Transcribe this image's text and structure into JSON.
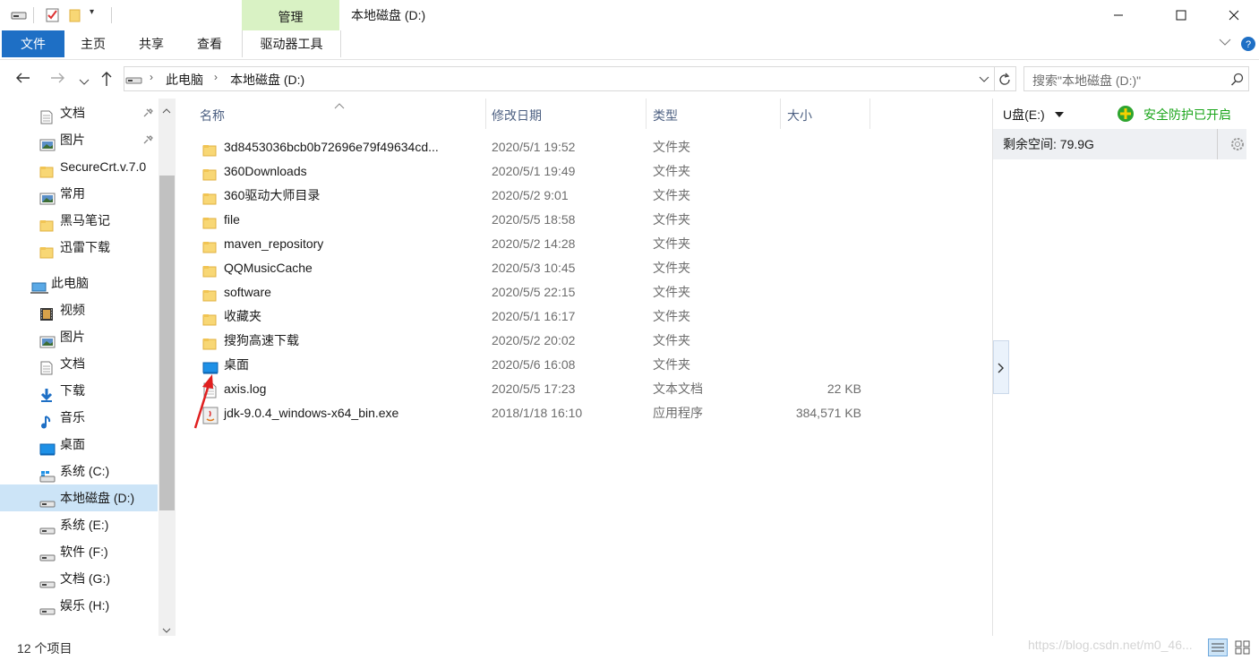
{
  "window": {
    "title": "本地磁盘 (D:)",
    "context_group": "管理"
  },
  "ribbon": {
    "tabs": [
      "文件",
      "主页",
      "共享",
      "查看"
    ],
    "drive_tab": "驱动器工具"
  },
  "address": {
    "crumbs": [
      "此电脑",
      "本地磁盘 (D:)"
    ],
    "search_placeholder": "搜索\"本地磁盘 (D:)\""
  },
  "nav": {
    "quick": [
      {
        "label": "文档",
        "icon": "document-icon",
        "pinned": true
      },
      {
        "label": "图片",
        "icon": "pictures-icon",
        "pinned": true
      },
      {
        "label": "SecureCrt.v.7.0",
        "icon": "folder-icon",
        "pinned": false
      },
      {
        "label": "常用",
        "icon": "pictures-icon",
        "pinned": false
      },
      {
        "label": "黑马笔记",
        "icon": "folder-icon",
        "pinned": false
      },
      {
        "label": "迅雷下载",
        "icon": "folder-icon",
        "pinned": false
      }
    ],
    "this_pc": "此电脑",
    "pc_items": [
      {
        "label": "视频",
        "icon": "video-icon"
      },
      {
        "label": "图片",
        "icon": "pictures-icon"
      },
      {
        "label": "文档",
        "icon": "document-icon"
      },
      {
        "label": "下载",
        "icon": "download-icon"
      },
      {
        "label": "音乐",
        "icon": "music-icon"
      },
      {
        "label": "桌面",
        "icon": "desktop-icon"
      },
      {
        "label": "系统 (C:)",
        "icon": "windows-drive-icon"
      },
      {
        "label": "本地磁盘 (D:)",
        "icon": "drive-icon",
        "selected": true
      },
      {
        "label": "系统 (E:)",
        "icon": "drive-icon"
      },
      {
        "label": "软件 (F:)",
        "icon": "drive-icon"
      },
      {
        "label": "文档 (G:)",
        "icon": "drive-icon"
      },
      {
        "label": "娱乐 (H:)",
        "icon": "drive-icon"
      }
    ]
  },
  "columns": {
    "name": "名称",
    "date": "修改日期",
    "type": "类型",
    "size": "大小"
  },
  "files": [
    {
      "name": "3d8453036bcb0b72696e79f49634cd...",
      "date": "2020/5/1 19:52",
      "type": "文件夹",
      "size": "",
      "icon": "folder-icon"
    },
    {
      "name": "360Downloads",
      "date": "2020/5/1 19:49",
      "type": "文件夹",
      "size": "",
      "icon": "folder-icon"
    },
    {
      "name": "360驱动大师目录",
      "date": "2020/5/2 9:01",
      "type": "文件夹",
      "size": "",
      "icon": "folder-icon"
    },
    {
      "name": "file",
      "date": "2020/5/5 18:58",
      "type": "文件夹",
      "size": "",
      "icon": "folder-icon"
    },
    {
      "name": "maven_repository",
      "date": "2020/5/2 14:28",
      "type": "文件夹",
      "size": "",
      "icon": "folder-icon"
    },
    {
      "name": "QQMusicCache",
      "date": "2020/5/3 10:45",
      "type": "文件夹",
      "size": "",
      "icon": "folder-icon"
    },
    {
      "name": "software",
      "date": "2020/5/5 22:15",
      "type": "文件夹",
      "size": "",
      "icon": "folder-icon"
    },
    {
      "name": "收藏夹",
      "date": "2020/5/1 16:17",
      "type": "文件夹",
      "size": "",
      "icon": "folder-icon"
    },
    {
      "name": "搜狗高速下载",
      "date": "2020/5/2 20:02",
      "type": "文件夹",
      "size": "",
      "icon": "folder-icon"
    },
    {
      "name": "桌面",
      "date": "2020/5/6 16:08",
      "type": "文件夹",
      "size": "",
      "icon": "desktop-icon"
    },
    {
      "name": "axis.log",
      "date": "2020/5/5 17:23",
      "type": "文本文档",
      "size": "22 KB",
      "icon": "text-file-icon"
    },
    {
      "name": "jdk-9.0.4_windows-x64_bin.exe",
      "date": "2018/1/18 16:10",
      "type": "应用程序",
      "size": "384,571 KB",
      "icon": "java-exe-icon"
    }
  ],
  "right_panel": {
    "drive_label": "U盘(E:)",
    "protect_label": "安全防护已开启",
    "free_space": "剩余空间: 79.9G"
  },
  "status": {
    "count": "12 个项目",
    "watermark": "https://blog.csdn.net/m0_46..."
  },
  "colors": {
    "file_tab": "#1e6fc5",
    "context_group": "#d9f2c4",
    "selected": "#cce4f7",
    "protect_green": "#1aa51a",
    "arrow_red": "#e02020"
  }
}
